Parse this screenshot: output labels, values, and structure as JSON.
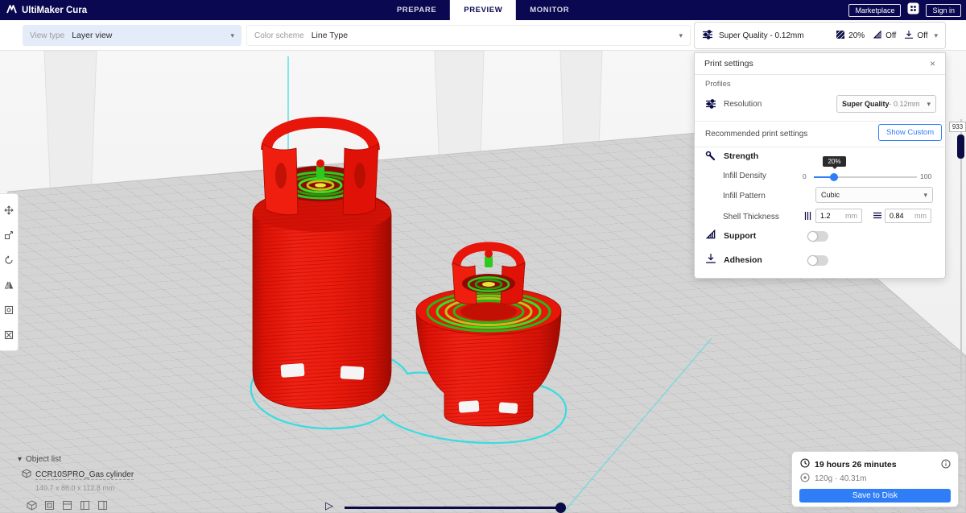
{
  "header": {
    "app_title": "UltiMaker Cura",
    "tabs": [
      {
        "label": "PREPARE"
      },
      {
        "label": "PREVIEW"
      },
      {
        "label": "MONITOR"
      }
    ],
    "marketplace_label": "Marketplace",
    "sign_in_label": "Sign in"
  },
  "view_bar": {
    "view_type_label": "View type",
    "view_type_value": "Layer view",
    "color_scheme_label": "Color scheme",
    "color_scheme_value": "Line Type"
  },
  "setup_summary": {
    "profile": "Super Quality - 0.12mm",
    "infill": "20%",
    "support": "Off",
    "adhesion": "Off"
  },
  "print_settings": {
    "title": "Print settings",
    "profiles_label": "Profiles",
    "resolution_label": "Resolution",
    "resolution_value": "Super Quality",
    "resolution_detail": " - 0.12mm",
    "recommended_label": "Recommended print settings",
    "show_custom_label": "Show Custom",
    "strength_title": "Strength",
    "infill_density_label": "Infill Density",
    "slider_min": "0",
    "slider_max": "100",
    "slider_tooltip": "20%",
    "infill_pattern_label": "Infill Pattern",
    "infill_pattern_value": "Cubic",
    "shell_thickness_label": "Shell Thickness",
    "wall_value": "1.2",
    "wall_unit": "mm",
    "top_bottom_value": "0.84",
    "top_bottom_unit": "mm",
    "support_label": "Support",
    "adhesion_label": "Adhesion"
  },
  "layer_slider": {
    "current_layer": "933"
  },
  "object_list": {
    "toggle_label": "Object list",
    "items": [
      {
        "name": "CCR10SPRO_Gas cylinder",
        "dimensions": "140.7 x 86.0 x 112.8 mm"
      }
    ]
  },
  "job_summary": {
    "print_time": "19 hours 26 minutes",
    "material_usage": "120g · 40.31m",
    "save_button_label": "Save to Disk"
  },
  "glyphs": {
    "chevron_down": "▾",
    "close": "×",
    "play": "▷"
  },
  "colors": {
    "topbar_navy": "#0a0850",
    "accent_blue": "#2f7ef7",
    "model_red": "#e8150a",
    "layer_green": "#2ec91e",
    "skirt_cyan": "#2fdde2"
  }
}
